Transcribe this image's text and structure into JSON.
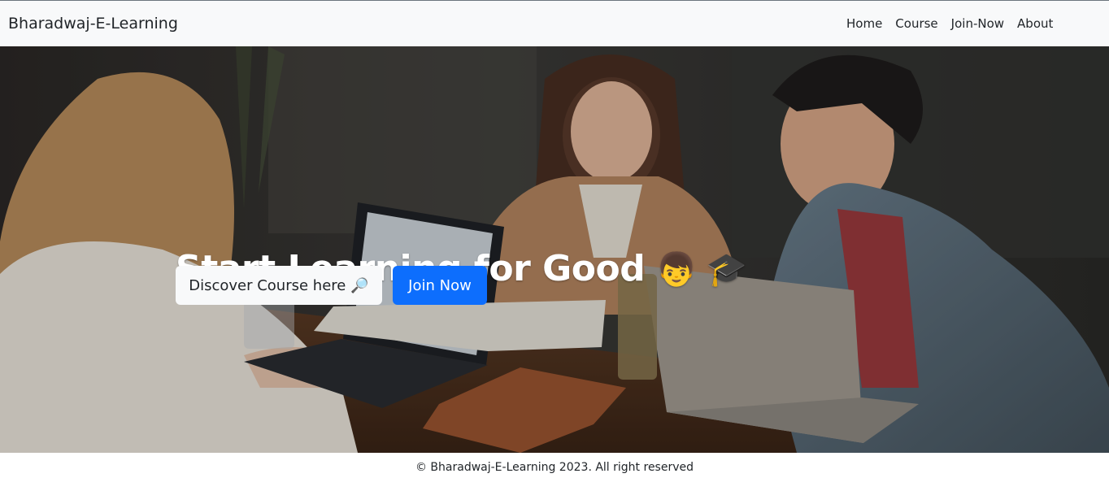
{
  "navbar": {
    "brand": "Bharadwaj-E-Learning",
    "links": [
      "Home",
      "Course",
      "Join-Now",
      "About"
    ]
  },
  "hero": {
    "title": "Start Learning for Good",
    "title_emoji": "👦 🎓",
    "discover_label": "Discover Course here",
    "discover_icon": "🔎",
    "join_label": "Join Now",
    "photo": "photo of three people laughing around a table with laptops"
  },
  "footer": {
    "text": "© Bharadwaj-E-Learning 2023. All right reserved"
  },
  "colors": {
    "navbar_bg": "#f8f9fa",
    "primary": "#0d6efd",
    "light_button": "#f8f9fa"
  }
}
